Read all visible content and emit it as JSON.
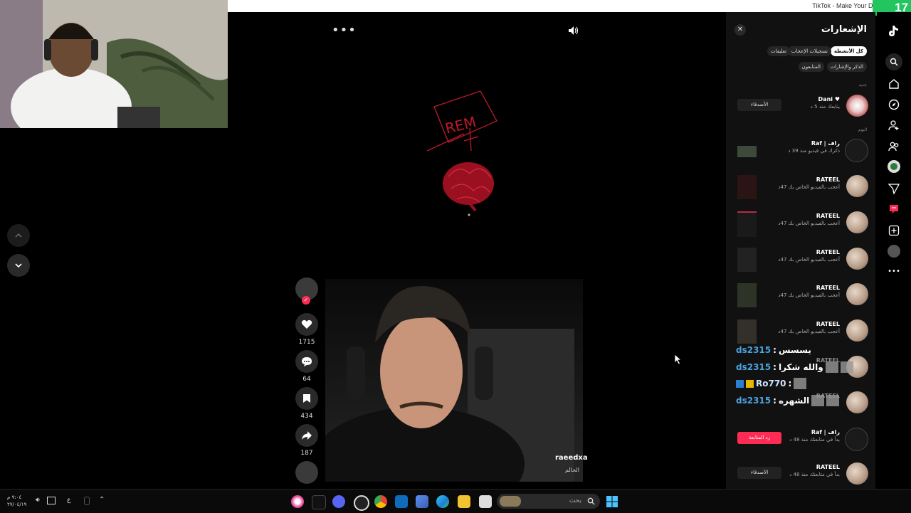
{
  "browser": {
    "title": "TikTok - Make Your Day",
    "overlay_counter": "17"
  },
  "video": {
    "drawing_text": "REM",
    "author": "raeedxa",
    "caption": "الحالم",
    "actions": [
      {
        "name": "like",
        "count": "1715"
      },
      {
        "name": "comment",
        "count": "64"
      },
      {
        "name": "save",
        "count": "434"
      },
      {
        "name": "share",
        "count": "187"
      }
    ]
  },
  "notifications": {
    "title": "الإشعارات",
    "filters_row1": [
      "كل الأنشطة",
      "تسجيلات الإعجاب",
      "تعليقات"
    ],
    "filters_row2": [
      "الذكر والإشارات",
      "المتابعون"
    ],
    "section_new": "جديد",
    "section_today": "اليوم",
    "items": [
      {
        "name": "Dani",
        "desc": "يتابعك منذ 5 د",
        "button": "الأصدقاء"
      },
      {
        "name": "راف | Raf",
        "desc": "ذكرك في فيديو منذ 39 د"
      },
      {
        "name": "RATEEL",
        "desc": "أعجب بالفيديو الخاص بك 47د"
      },
      {
        "name": "RATEEL",
        "desc": "أعجب بالفيديو الخاص بك 47د"
      },
      {
        "name": "RATEEL",
        "desc": "أعجب بالفيديو الخاص بك 47د"
      },
      {
        "name": "RATEEL",
        "desc": "أعجب بالفيديو الخاص بك 47د"
      },
      {
        "name": "RATEEL",
        "desc": "أعجب بالفيديو الخاص بك 47د"
      },
      {
        "name": "RATEEL",
        "desc": ""
      },
      {
        "name": "RATEEL",
        "desc": ""
      },
      {
        "name": "راف | Raf",
        "desc": "بدأ في متابعتك منذ 48 د",
        "button": "رد المتابعة"
      },
      {
        "name": "RATEEL",
        "desc": "بدأ في متابعتك منذ 48 د",
        "button": "الأصدقاء"
      }
    ]
  },
  "chat": [
    {
      "user": "ds2315",
      "message": "يسسس"
    },
    {
      "user": "ds2315",
      "message": "والله شكرا"
    },
    {
      "user": "Ro770",
      "message": ""
    },
    {
      "user": "ds2315",
      "message": "الشهره"
    }
  ],
  "taskbar": {
    "search_placeholder": "بحث",
    "clock_time": "٩:٠٤ م",
    "clock_date": "٢٧/٠٤/١٩",
    "lang": "ع"
  },
  "colors": {
    "accent_pink": "#fe2c55",
    "chat_user": "#4aa3df",
    "overlay_green": "#22c55e"
  }
}
